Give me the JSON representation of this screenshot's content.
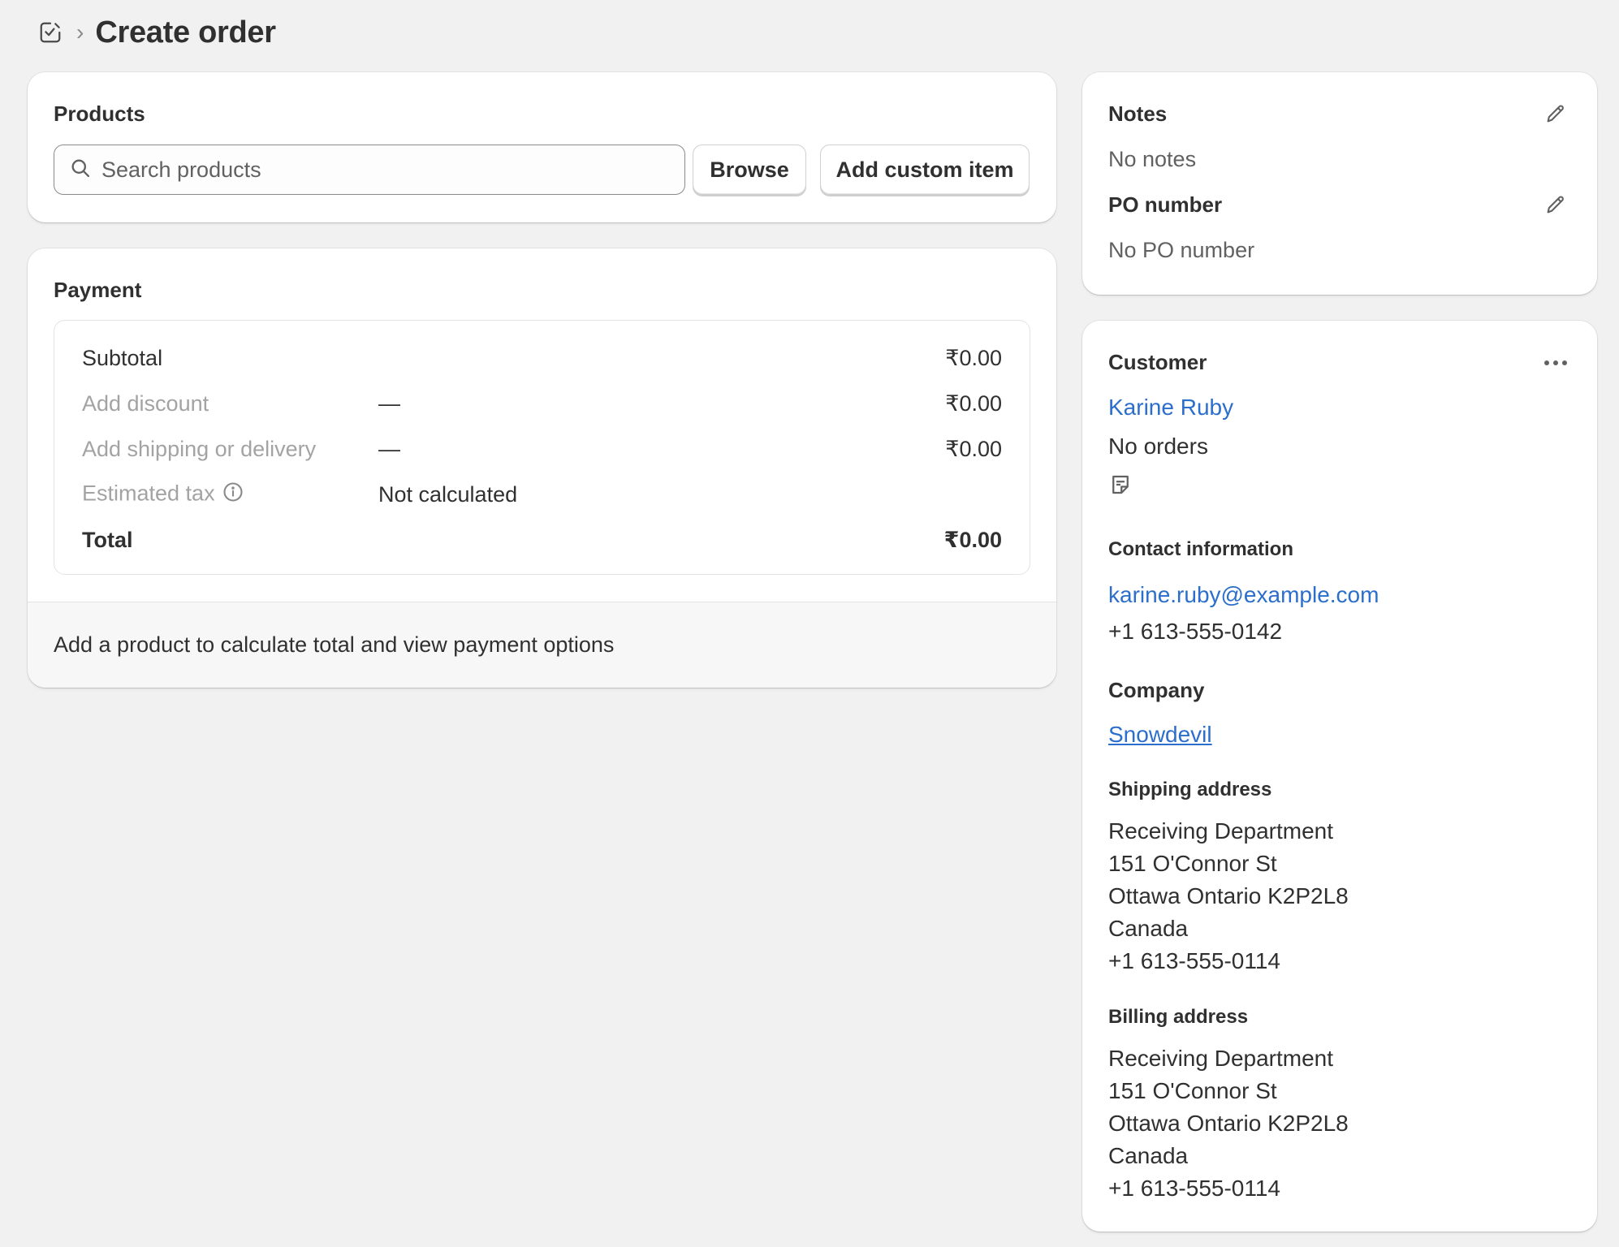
{
  "header": {
    "title": "Create order",
    "breadcrumb_separator": "›"
  },
  "products": {
    "title": "Products",
    "search_placeholder": "Search products",
    "browse_label": "Browse",
    "add_custom_label": "Add custom item"
  },
  "payment": {
    "title": "Payment",
    "rows": [
      {
        "label": "Subtotal",
        "middle": "",
        "amount": "₹0.00"
      },
      {
        "label": "Add discount",
        "middle": "—",
        "amount": "₹0.00"
      },
      {
        "label": "Add shipping or delivery",
        "middle": "—",
        "amount": "₹0.00"
      },
      {
        "label": "Estimated tax",
        "middle": "Not calculated",
        "amount": ""
      },
      {
        "label": "Total",
        "middle": "",
        "amount": "₹0.00"
      }
    ],
    "footer_text": "Add a product to calculate total and view payment options"
  },
  "notes": {
    "title": "Notes",
    "value": "No notes",
    "po_title": "PO number",
    "po_value": "No PO number"
  },
  "customer": {
    "title": "Customer",
    "name": "Karine Ruby",
    "orders": "No orders",
    "contact_title": "Contact information",
    "email": "karine.ruby@example.com",
    "phone": "+1 613-555-0142",
    "company_title": "Company",
    "company": "Snowdevil",
    "shipping_title": "Shipping address",
    "shipping_lines": [
      "Receiving Department",
      "151 O'Connor St",
      "Ottawa Ontario K2P2L8",
      "Canada",
      "+1 613-555-0114"
    ],
    "billing_title": "Billing address",
    "billing_lines": [
      "Receiving Department",
      "151 O'Connor St",
      "Ottawa Ontario K2P2L8",
      "Canada",
      "+1 613-555-0114"
    ]
  },
  "colors": {
    "background": "#f1f1f1",
    "card": "#ffffff",
    "link": "#2c6ecb",
    "text": "#303030",
    "muted": "#a3a3a3"
  },
  "icons": {
    "header": "order-edit-icon",
    "search": "search-icon",
    "edit": "pencil-icon",
    "menu": "more-horizontal-icon",
    "note": "note-icon",
    "info": "info-icon"
  }
}
